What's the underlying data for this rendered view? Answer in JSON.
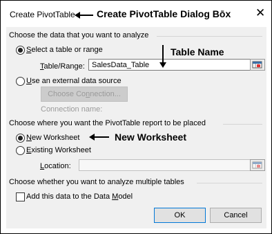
{
  "dialog": {
    "title": "Create PivotTable",
    "close_glyph": "✕"
  },
  "section_data": {
    "heading": "Choose the data that you want to analyze",
    "select_table": {
      "accel": "S",
      "rest": "elect a table or range",
      "selected": true
    },
    "table_range": {
      "accel": "T",
      "rest": "able/Range:",
      "value": "SalesData_Table"
    },
    "external": {
      "accel": "U",
      "rest": "se an external data source",
      "selected": false
    },
    "choose_connection": {
      "pre": "Choose Co",
      "accel": "n",
      "post": "nection..."
    },
    "connection_name_label": "Connection name:"
  },
  "section_place": {
    "heading": "Choose where you want the PivotTable report to be placed",
    "new_ws": {
      "accel": "N",
      "rest": "ew Worksheet",
      "selected": true
    },
    "existing_ws": {
      "accel": "E",
      "rest": "xisting Worksheet",
      "selected": false
    },
    "location": {
      "accel": "L",
      "rest": "ocation:",
      "value": ""
    }
  },
  "section_multi": {
    "heading": "Choose whether you want to analyze multiple tables",
    "data_model": {
      "pre": "Add this data to the Data ",
      "accel": "M",
      "post": "odel",
      "checked": false
    }
  },
  "buttons": {
    "ok": "OK",
    "cancel": "Cancel"
  },
  "annotations": {
    "title_note": "Create PivotTable Dialog Bōx",
    "table_name_note": "Table Name",
    "new_ws_note": "New Worksheet"
  },
  "icons": {
    "range_selector": "range-selector-icon",
    "arrow": "arrow-left-icon",
    "arrow_down": "arrow-down-icon"
  }
}
